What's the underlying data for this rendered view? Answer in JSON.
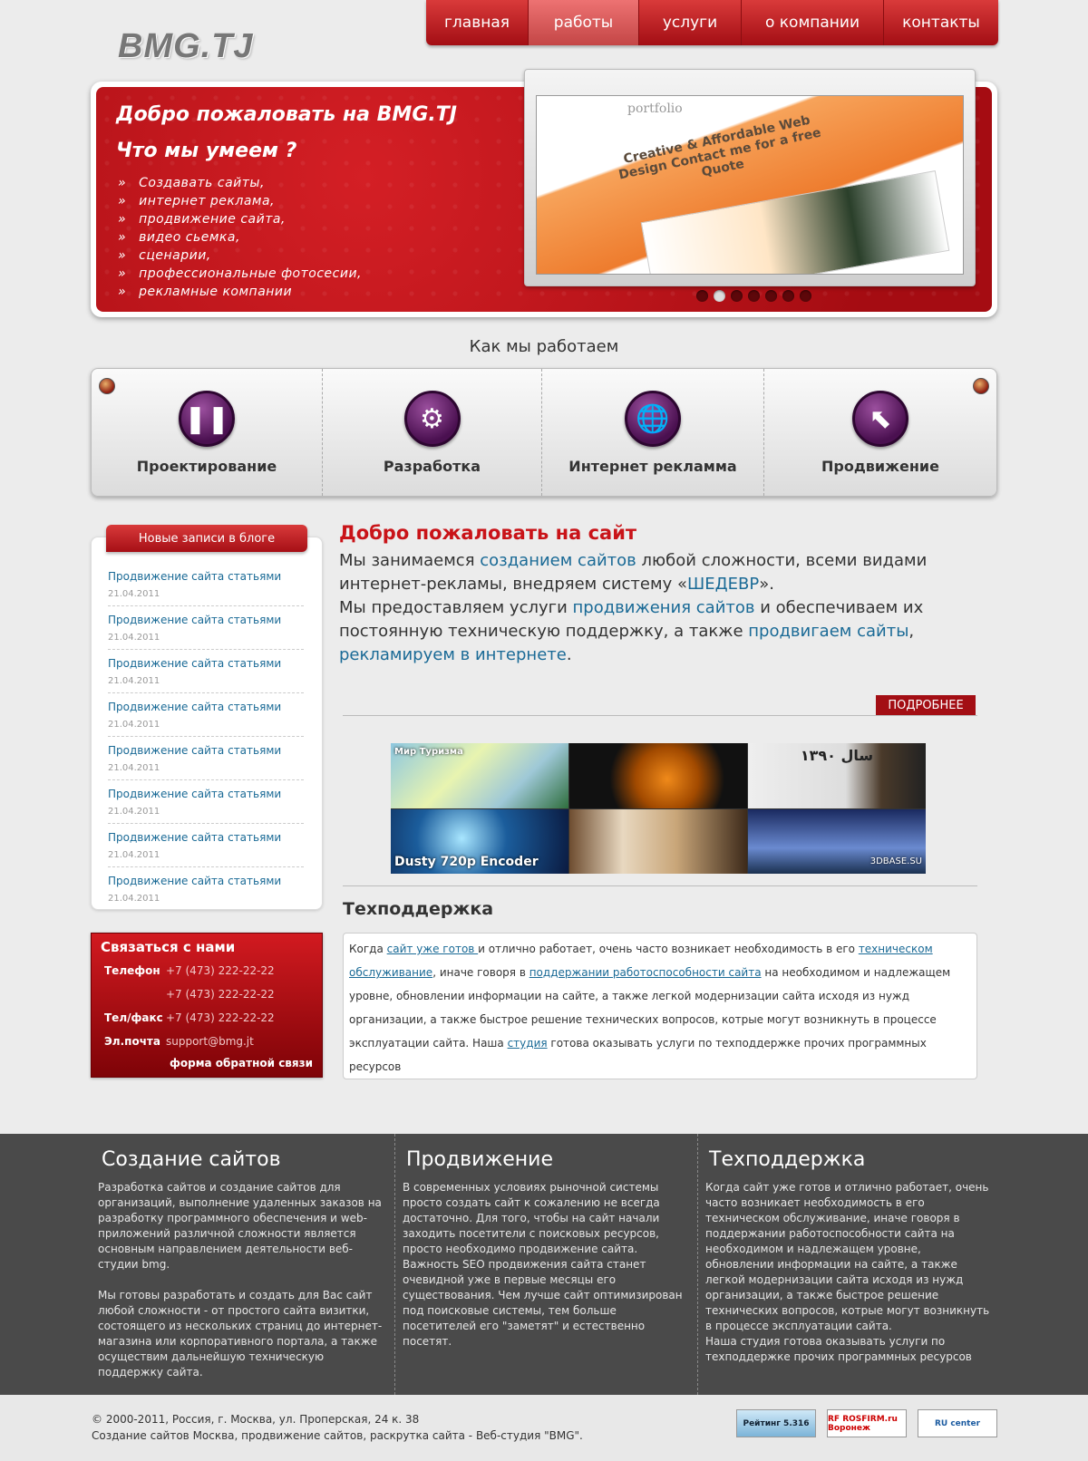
{
  "header": {
    "logo": "BMG.TJ",
    "nav": [
      "главная",
      "работы",
      "услуги",
      "о компании",
      "контакты"
    ],
    "active_nav": "работы"
  },
  "hero": {
    "title": "Добро пожаловать на BMG.TJ",
    "subtitle": "Что мы умеем ?",
    "items": [
      "Создавать сайты,",
      "интернет реклама,",
      "продвижение сайта,",
      "видео сьемка,",
      "сценарии,",
      "профессиональные фотосесии,",
      "рекламные компании"
    ],
    "showcase_brand": "portfolio",
    "showcase_banner": "Creative & Affordable Web Design Contact me for a free Quote",
    "slider_dots": 7,
    "active_dot": 2
  },
  "process": {
    "title": "Как мы работаем",
    "steps": [
      {
        "label": "Проектирование",
        "icon": "pause-icon"
      },
      {
        "label": "Разработка",
        "icon": "gear-icon"
      },
      {
        "label": "Интернет рекламма",
        "icon": "globe-icon"
      },
      {
        "label": "Продвижение",
        "icon": "arrow-up-left-icon"
      }
    ]
  },
  "blog": {
    "title": "Новые записи в блоге",
    "posts": [
      {
        "title": "Продвижение сайта статьями",
        "date": "21.04.2011"
      },
      {
        "title": "Продвижение сайта статьями",
        "date": "21.04.2011"
      },
      {
        "title": "Продвижение сайта статьями",
        "date": "21.04.2011"
      },
      {
        "title": "Продвижение сайта статьями",
        "date": "21.04.2011"
      },
      {
        "title": "Продвижение сайта статьями",
        "date": "21.04.2011"
      },
      {
        "title": "Продвижение сайта статьями",
        "date": "21.04.2011"
      },
      {
        "title": "Продвижение сайта статьями",
        "date": "21.04.2011"
      },
      {
        "title": "Продвижение сайта статьями",
        "date": "21.04.2011"
      }
    ]
  },
  "contact": {
    "title": "Связаться с нами",
    "phone_label": "Телефон",
    "phone1": "+7 (473) 222-22-22",
    "phone2": "+7 (473) 222-22-22",
    "fax_label": "Тел/факс",
    "fax": "+7 (473) 222-22-22",
    "email_label": "Эл.почта",
    "email": "support@bmg.jt",
    "form_link": "форма обратной связи"
  },
  "welcome": {
    "heading": "Добро пожаловать на сайт",
    "p1_a": "Мы занимаемся ",
    "p1_link1": "созданием сайтов",
    "p1_b": " любой сложности, всеми видами интернет-рекламы, внедряем систему «",
    "p1_link2": "ШЕДЕВР",
    "p1_c": "».",
    "p2_a": "Мы предоставляем услуги ",
    "p2_link1": "продвижения сайтов",
    "p2_b": " и обеспечиваем их постоянную техническую поддержку, а также ",
    "p2_link2": "продвигаем сайты",
    "p2_c": ",",
    "p2_link3": "рекламируем в интернете",
    "p2_d": ".",
    "more": "ПОДРОБНЕЕ"
  },
  "gallery": {
    "captions": [
      "Мир Туризма",
      "",
      "سال ۱۳۹۰",
      "Dusty 720p Encoder",
      "",
      "3DBASE.SU"
    ]
  },
  "support": {
    "heading": "Техподдержка",
    "t1": "Когда ",
    "l1": "сайт уже готов ",
    "t2": "и отлично работает, очень часто возникает необходимость в его ",
    "l2": "техническом обслуживание",
    "t3": ", иначе говоря в ",
    "l3": "поддержании работоспособности сайта",
    "t4": " на необходимом и надлежащем уровне, обновлении информации на сайте, а также легкой модернизации сайта исходя из нужд организации, а также быстрое решение технических вопросов, котрые могут возникнуть в процессе эксплуатации сайта. Наша ",
    "l4": "студия",
    "t5": " готова оказывать услуги по техподдержке прочих программных ресурсов"
  },
  "footer": {
    "col1_title": "Создание сайтов",
    "col1_p1": "Разработка сайтов и создание сайтов для организаций, выполнение удаленных заказов на разработку программного обеспечения и web-приложений различной сложности является основным направлением деятельности веб-студии bmg.",
    "col1_p2": " Мы готовы разработать и создать для Вас сайт любой сложности - от простого сайта визитки, состоящего из нескольких страниц до интернет-магазина или корпоративного портала, а также осуществим дальнейшую техническую поддержку сайта.",
    "col2_title": "Продвижение",
    "col2_p1": "В современных условиях рыночной системы просто создать сайт к сожалению не всегда достаточно. Для того, чтобы на сайт начали заходить посетители с поисковых ресурсов, просто необходимо продвижение сайта. Важность SEO продвижения сайта станет очевидной уже в первые месяцы его существования. Чем лучше сайт оптимизирован  под поисковые системы, тем больше посетителей его \"заметят\" и естественно посетят.",
    "col3_title": "Техподдержка",
    "col3_p1": "Когда сайт уже готов и отлично работает, очень часто возникает необходимость в его техническом обслуживание, иначе говоря в поддержании работоспособности сайта на необходимом и надлежащем уровне, обновлении информации на сайте, а также легкой модернизации сайта исходя из нужд организации, а также быстрое решение технических вопросов, котрые могут возникнуть в процессе эксплуатации сайта.",
    "col3_p2": "Наша студия готова оказывать услуги по техподдержке прочих программных ресурсов"
  },
  "bottom": {
    "copy1": "© 2000-2011, Россия, г. Москва, ул. Проперская, 24 к. 38",
    "copy2": "Создание сайтов Москва, продвижение сайтов, раскрутка сайта - Веб-студия \"BMG\".",
    "badge1": "Рейтинг 5.316",
    "badge2": "RF ROSFIRM.ru Воронеж",
    "badge3": "RU center"
  }
}
